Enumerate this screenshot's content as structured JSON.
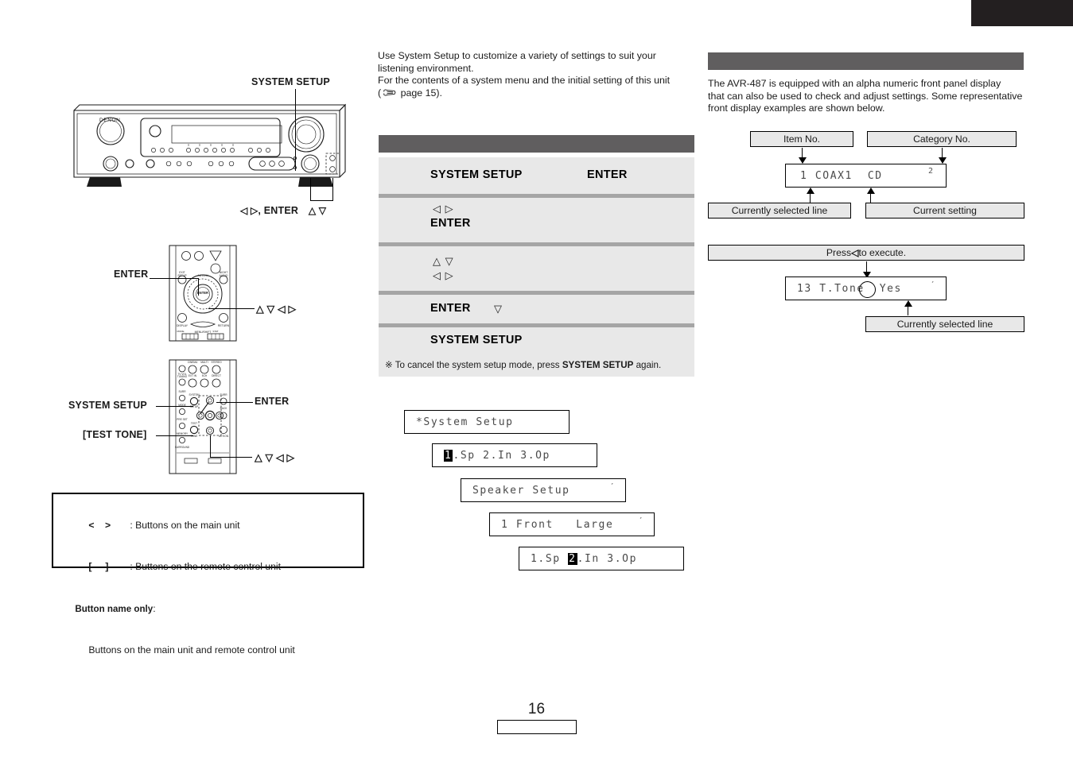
{
  "page": {
    "number": "16",
    "section_tab": ""
  },
  "left_column": {
    "main_unit_figure": {
      "brand": "DENON",
      "callouts": {
        "system_setup": "SYSTEM SETUP",
        "cursor_enter": "ENTER",
        "cursor_lr_glyph": "◁ ▷",
        "cursor_lr_suffix": ", ",
        "updown_glyph": "△ ▽"
      }
    },
    "remote_figure_1": {
      "callouts": {
        "enter": "ENTER",
        "cursor_glyph": "△ ▽ ◁ ▷"
      }
    },
    "remote_figure_2": {
      "callouts": {
        "system_setup": "SYSTEM SETUP",
        "test_tone": "[TEST TONE]",
        "enter": "ENTER",
        "cursor_glyph": "△ ▽ ◁ ▷"
      }
    },
    "legend": {
      "line1_symbol": "<    >",
      "line1_text": ": Buttons on the main unit",
      "line2_symbol": "[     ]",
      "line2_text": ": Buttons on the remote control unit",
      "line3_bold": "Button name only",
      "line3_colon": ":",
      "line4_text": "Buttons on the main unit and remote control unit"
    }
  },
  "middle_column": {
    "intro_line1": "Use System Setup to customize a variety of settings to suit your",
    "intro_line2": "listening environment.",
    "intro_line3": "For the contents of a system menu and the initial setting of this unit",
    "intro_line4_pre": "(",
    "intro_line4_post": " page 15).",
    "procedure_header": "",
    "procedure_rows": [
      {
        "left": "SYSTEM SETUP",
        "right": "ENTER",
        "arrows_top": "",
        "arrows_bottom": ""
      },
      {
        "left": "ENTER",
        "right": "",
        "arrows_top": "◁ ▷",
        "arrows_bottom": ""
      },
      {
        "left": "",
        "right": "",
        "arrows_top": "△ ▽",
        "arrows_bottom": "◁ ▷"
      },
      {
        "left": "ENTER",
        "right": "",
        "arrows_top": "",
        "arrows_bottom": "",
        "trailing_glyph": "▽"
      },
      {
        "left": "SYSTEM SETUP",
        "right": "",
        "arrows_top": "",
        "arrows_bottom": ""
      }
    ],
    "note_mark": "※",
    "note_pre": "To cancel the system setup mode, press ",
    "note_bold": "SYSTEM SETUP",
    "note_post": " again.",
    "lcd_examples": [
      {
        "text": "*System Setup",
        "highlight": "",
        "tick": ""
      },
      {
        "pre": "",
        "highlight": "1",
        "post": ".Sp 2.In 3.Op",
        "tick": ""
      },
      {
        "text": "Speaker Setup",
        "highlight": "",
        "tick": "′"
      },
      {
        "text": "1 Front   Large",
        "highlight": "",
        "tick": "′"
      },
      {
        "pre": "1.Sp ",
        "highlight": "2",
        "post": ".In 3.Op",
        "tick": ""
      }
    ]
  },
  "right_column": {
    "header": "",
    "intro_line1": "The AVR-487 is equipped with an alpha numeric front panel display",
    "intro_line2": "that can also be used to check and adjust settings. Some representative",
    "intro_line3": "front display examples are shown below.",
    "diagram1": {
      "label_item_no": "Item No.",
      "label_category_no": "Category No.",
      "label_selected_line": "Currently selected line",
      "label_current_setting": "Current setting",
      "display_text": "1 COAX1  CD",
      "display_superscript": "2"
    },
    "diagram2": {
      "label_press_execute_pre": "Press ",
      "label_press_execute_glyph": "◁",
      "label_press_execute_post": " to execute.",
      "label_selected_line": "Currently selected line",
      "display_text": "13 T.Tone  Yes",
      "display_tick": "′"
    }
  },
  "colors": {
    "header_bar": "#605e5f",
    "row_bg": "#e8e8e8",
    "row_sep": "#a5a5a5",
    "callbox_bg": "#e8e8e8",
    "section_tab": "#231f20"
  }
}
